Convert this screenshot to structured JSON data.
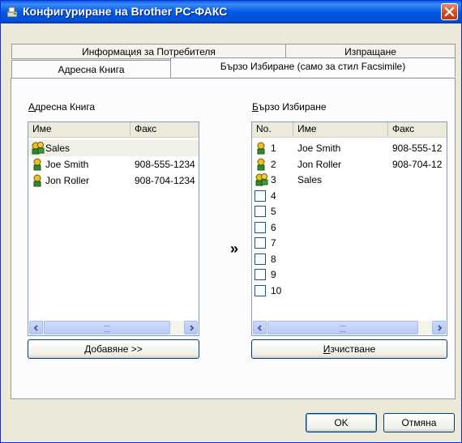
{
  "window": {
    "title": "Конфигуриране на Brother PC-ФАКС",
    "close_icon": "close-icon"
  },
  "tabs": {
    "back_row": [
      "Информация за Потребителя",
      "Изпращане"
    ],
    "front_row": [
      "Адресна Книга",
      "Бързо Избиране (само за стил Facsimile)"
    ],
    "active": "Бързо Избиране (само за стил Facsimile)"
  },
  "address_book": {
    "label_underlined": "А",
    "label_rest": "дресна Книга",
    "columns": [
      "Име",
      "Факс"
    ],
    "rows": [
      {
        "icon": "group-icon",
        "name": "Sales",
        "fax": ""
      },
      {
        "icon": "person-icon",
        "name": "Joe Smith",
        "fax": "908-555-1234"
      },
      {
        "icon": "person-icon",
        "name": "Jon Roller",
        "fax": "908-704-1234"
      }
    ],
    "add_button_underlined": "Д",
    "add_button_rest": "обавяне >>"
  },
  "transfer_glyph": "»",
  "speed_dial": {
    "label_underlined": "Б",
    "label_rest": "ързо Избиране",
    "columns": [
      "No.",
      "Име",
      "Факс"
    ],
    "rows": [
      {
        "no": "1",
        "icon": "person-icon",
        "name": "Joe Smith",
        "fax": "908-555-12"
      },
      {
        "no": "2",
        "icon": "person-icon",
        "name": "Jon Roller",
        "fax": "908-704-12"
      },
      {
        "no": "3",
        "icon": "group-icon",
        "name": "Sales",
        "fax": ""
      },
      {
        "no": "4",
        "icon": "empty",
        "name": "",
        "fax": ""
      },
      {
        "no": "5",
        "icon": "empty",
        "name": "",
        "fax": ""
      },
      {
        "no": "6",
        "icon": "empty",
        "name": "",
        "fax": ""
      },
      {
        "no": "7",
        "icon": "empty",
        "name": "",
        "fax": ""
      },
      {
        "no": "8",
        "icon": "empty",
        "name": "",
        "fax": ""
      },
      {
        "no": "9",
        "icon": "empty",
        "name": "",
        "fax": ""
      },
      {
        "no": "10",
        "icon": "empty",
        "name": "",
        "fax": ""
      }
    ],
    "clear_button_underlined": "И",
    "clear_button_rest": "зчистване"
  },
  "footer": {
    "ok_label": "OK",
    "cancel_label": "Отмяна"
  },
  "colors": {
    "titlebar": "#0058e6",
    "dialog_bg": "#ece9d8",
    "panel_bg": "#fcfcfe",
    "close_button": "#d3461f"
  }
}
